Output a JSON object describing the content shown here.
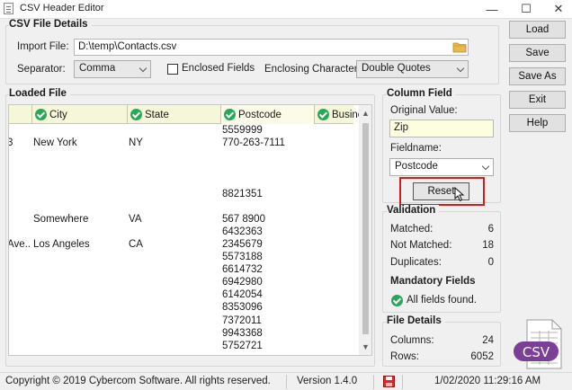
{
  "window": {
    "title": "CSV Header Editor",
    "min_glyph": "—",
    "max_glyph": "☐",
    "close_glyph": "✕"
  },
  "csv_file_details": {
    "title": "CSV File Details",
    "import_file_label": "Import File:",
    "import_file_value": "D:\\temp\\Contacts.csv",
    "separator_label": "Separator:",
    "separator_value": "Comma",
    "enclosed_label": "Enclosed Fields",
    "enclosed_checked": false,
    "enclosing_char_label": "Enclosing Character:",
    "enclosing_char_value": "Double Quotes"
  },
  "buttons": {
    "load": "Load",
    "save": "Save",
    "save_as": "Save As",
    "exit": "Exit",
    "help": "Help"
  },
  "loaded_file": {
    "title": "Loaded File",
    "columns": [
      "City",
      "State",
      "Postcode",
      "Busines"
    ],
    "rows": [
      {
        "prefix": "",
        "city": "",
        "state": "",
        "postcode": "5559999"
      },
      {
        "prefix": "3",
        "city": "New York",
        "state": "NY",
        "postcode": "770-263-7111"
      },
      {
        "prefix": "",
        "city": "",
        "state": "",
        "postcode": ""
      },
      {
        "prefix": "",
        "city": "",
        "state": "",
        "postcode": ""
      },
      {
        "prefix": "",
        "city": "",
        "state": "",
        "postcode": ""
      },
      {
        "prefix": "",
        "city": "",
        "state": "",
        "postcode": "8821351"
      },
      {
        "prefix": "",
        "city": "",
        "state": "",
        "postcode": ""
      },
      {
        "prefix": "",
        "city": "Somewhere",
        "state": "VA",
        "postcode": "567 8900"
      },
      {
        "prefix": "",
        "city": "",
        "state": "",
        "postcode": "6432363"
      },
      {
        "prefix": "Ave...",
        "city": "Los Angeles",
        "state": "CA",
        "postcode": "2345679"
      },
      {
        "prefix": "",
        "city": "",
        "state": "",
        "postcode": "5573188"
      },
      {
        "prefix": "",
        "city": "",
        "state": "",
        "postcode": "6614732"
      },
      {
        "prefix": "",
        "city": "",
        "state": "",
        "postcode": "6942980"
      },
      {
        "prefix": "",
        "city": "",
        "state": "",
        "postcode": "6142054"
      },
      {
        "prefix": "",
        "city": "",
        "state": "",
        "postcode": "8353096"
      },
      {
        "prefix": "",
        "city": "",
        "state": "",
        "postcode": "7372011"
      },
      {
        "prefix": "",
        "city": "",
        "state": "",
        "postcode": "9943368"
      },
      {
        "prefix": "",
        "city": "",
        "state": "",
        "postcode": "5752721"
      }
    ]
  },
  "column_field": {
    "title": "Column Field",
    "original_value_label": "Original Value:",
    "original_value": "Zip",
    "fieldname_label": "Fieldname:",
    "fieldname_value": "Postcode",
    "reset_label": "Reset"
  },
  "validation": {
    "title": "Validation",
    "matched_label": "Matched:",
    "matched_value": "6",
    "not_matched_label": "Not Matched:",
    "not_matched_value": "18",
    "duplicates_label": "Duplicates:",
    "duplicates_value": "0",
    "mandatory_title": "Mandatory Fields",
    "mandatory_status": "All fields found."
  },
  "file_details": {
    "title": "File Details",
    "columns_label": "Columns:",
    "columns_value": "24",
    "rows_label": "Rows:",
    "rows_value": "6052",
    "csv_badge": "CSV"
  },
  "status_bar": {
    "copyright": "Copyright © 2019 Cybercom Software.  All rights reserved.",
    "version": "Version 1.4.0",
    "datetime": "1/02/2020 11:29:16 AM"
  },
  "colors": {
    "highlight_border": "#d11d1d",
    "check_green": "#27a85a",
    "csv_purple": "#7b3f98",
    "header_bg": "#f6f7d8",
    "original_value_bg": "#fdfde0"
  }
}
